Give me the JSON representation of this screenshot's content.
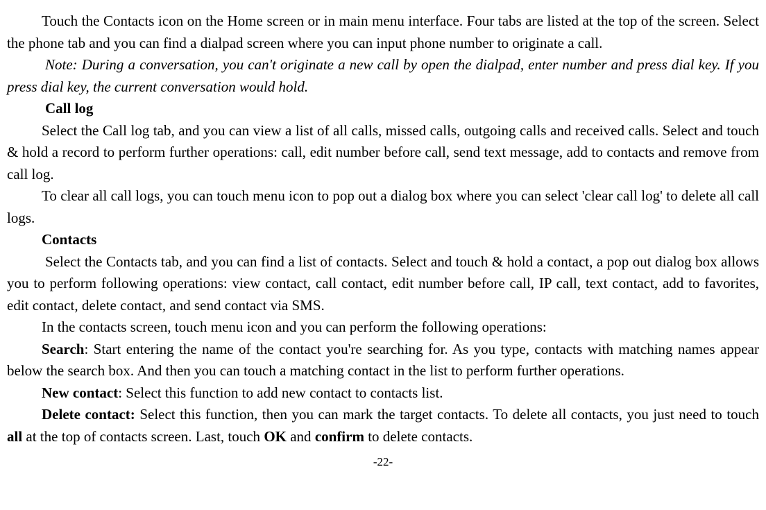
{
  "p1": "Touch the Contacts icon on the Home screen or in main menu interface. Four tabs are listed at the top of the screen. Select the phone tab and you can find a dialpad screen where you can input phone number to originate a call.",
  "p2": "Note: During a conversation, you can't originate a new call by open the dialpad, enter number and press dial key. If you press dial key, the current conversation would hold.",
  "h1": "Call log",
  "p3": "Select the Call log tab, and you can view a list of all calls, missed calls, outgoing calls and received calls. Select and touch & hold a record to perform further operations: call, edit number before call, send text message, add to contacts and remove from call log.",
  "p4": "To clear all call logs, you can touch menu icon to pop out a dialog box where you can select 'clear call log' to delete all call logs.",
  "h2": "Contacts",
  "p5": "Select the Contacts tab, and you can find a list of contacts. Select and touch & hold a contact, a pop out dialog box allows you to perform following operations: view contact, call contact, edit number before call, IP call, text contact, add to favorites, edit contact, delete contact, and send contact via SMS.",
  "p6": "In the contacts screen, touch menu icon and you can perform the following operations:",
  "p7_bold": "Search",
  "p7_rest": ": Start entering the name of the contact you're searching for. As you type, contacts with matching names appear below the search box. And then you can touch a matching contact in the list to perform further operations.",
  "p8_bold": "New contact",
  "p8_rest": ": Select this function to add new contact to contacts list.",
  "p9_bold": "Delete contact: ",
  "p9_part1": "Select this function, then you can mark the target contacts. To delete all contacts, you just need to touch ",
  "p9_bold2": "all",
  "p9_part2": " at the top of contacts screen. Last, touch ",
  "p9_bold3": "OK",
  "p9_part3": " and ",
  "p9_bold4": "confirm",
  "p9_part4": " to delete contacts.",
  "page_num": "-22-"
}
